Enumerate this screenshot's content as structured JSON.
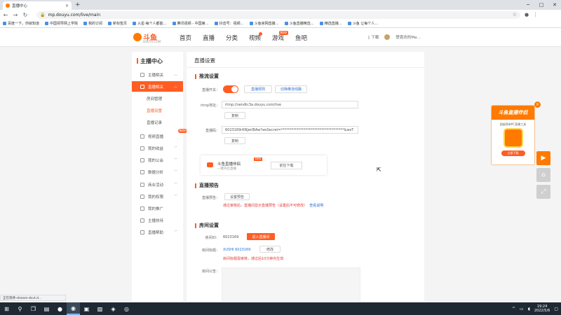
{
  "browser": {
    "tab_title": "直播中心",
    "tab_close": "×",
    "new_tab": "+",
    "url": "mp.douyu.com/live/main",
    "win_min": "─",
    "win_max": "□",
    "win_close": "✕",
    "bookmarks": [
      "百度一下，你就知道",
      "中国领导网上学院",
      "我的订阅",
      "新标签页",
      "火星·每个人都能…",
      "腾讯视频 - 中国第…",
      "抖音号：视频…",
      "斗鱼官网直播…",
      "斗鱼直播精选…",
      "精选直播…",
      "斗鱼 让每个人…"
    ]
  },
  "site": {
    "logo_text": "斗鱼",
    "logo_sub": "DOUYU.COM",
    "nav": [
      {
        "label": "首页"
      },
      {
        "label": "直播"
      },
      {
        "label": "分类"
      },
      {
        "label": "视频"
      },
      {
        "label": "游戏",
        "badge": "NEW"
      },
      {
        "label": "鱼吧"
      }
    ],
    "download": "下载",
    "username": "楚喜欢的Ma…"
  },
  "sidebar": {
    "title": "主播中心",
    "items": [
      {
        "label": "主播相关"
      },
      {
        "label": "直播相关"
      },
      {
        "label": "房间管理"
      },
      {
        "label": "直播设置"
      },
      {
        "label": "直播记录"
      },
      {
        "label": "视频直播"
      },
      {
        "label": "我的收益"
      },
      {
        "label": "我的公会"
      },
      {
        "label": "数据分析"
      },
      {
        "label": "商业活动"
      },
      {
        "label": "我的权限"
      },
      {
        "label": "我的推广"
      },
      {
        "label": "主播扶持"
      },
      {
        "label": "直播帮助"
      }
    ],
    "new_badge": "NEW"
  },
  "main": {
    "page_title": "直播设置",
    "stream": {
      "heading": "推流设置",
      "switch_label": "直播开关：",
      "btn_rules": "直播规则",
      "btn_tools": "切换推流线路",
      "rtmp_label": "rtmp地址：",
      "rtmp_value": "rtmp://sendtc3a.douyu.com/live",
      "copy1": "复制",
      "code_label": "直播码：",
      "code_value": "6023169rKNJerIBAw?wsSecret=************************************&wsT",
      "copy2": "复制"
    },
    "promo": {
      "title": "斗鱼直播伴侣",
      "subtitle": "一键开启直播",
      "new": "NEW",
      "btn": "前往下载"
    },
    "preview": {
      "heading": "直播预告",
      "label": "直播预告：",
      "btn": "设置预告",
      "note": "通过审核后，直播间显示直播预告（设置后不可修改）",
      "note_link": "查看说明"
    },
    "room": {
      "heading": "房间设置",
      "id_label": "房间ID：",
      "id_value": "6023169",
      "enter_btn": "进入直播间",
      "title_label": "房间标题：",
      "title_value": "XUSHI 6023169",
      "edit_btn": "修改",
      "title_note": "房间标题需审核，通过后10分钟内生效",
      "notice_label": "房间公告："
    }
  },
  "float": {
    "card_title": "斗鱼直播伴侣",
    "card_desc": "超级简单PC直播工具",
    "card_btn": "立即下载",
    "close": "×"
  },
  "status_text": "正在等待 stream-dcvt.d...",
  "taskbar": {
    "time": "19:24",
    "date": "2022/5/6"
  }
}
